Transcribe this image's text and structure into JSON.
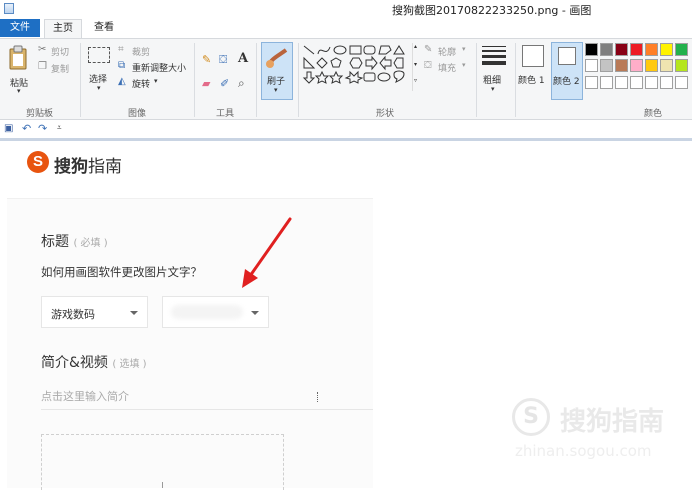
{
  "window": {
    "title": "搜狗截图20170822233250.png - 画图"
  },
  "ribbon_tabs": {
    "file": "文件",
    "home": "主页",
    "view": "查看"
  },
  "clipboard": {
    "paste_label": "粘贴",
    "cut_label": "剪切",
    "copy_label": "复制",
    "group_label": "剪贴板"
  },
  "image": {
    "select_label": "选择",
    "crop_label": "裁剪",
    "resize_label": "重新调整大小",
    "rotate_label": "旋转",
    "group_label": "图像"
  },
  "tools": {
    "text_tool_glyph": "A",
    "group_label": "工具"
  },
  "brushes": {
    "label": "刷子"
  },
  "shapes": {
    "outline_label": "轮廓",
    "fill_label": "填充",
    "group_label": "形状"
  },
  "size": {
    "label": "粗细"
  },
  "colors": {
    "color1_label": "颜色 1",
    "color2_label": "颜色 2",
    "group_label": "颜色",
    "palette_row1": [
      "#000000",
      "#7f7f7f",
      "#880015",
      "#ed1c24",
      "#ff7f27",
      "#fff200",
      "#22b14c"
    ],
    "palette_row2": [
      "#ffffff",
      "#c3c3c3",
      "#b97a57",
      "#ffaec9",
      "#ffc90e",
      "#efe4b0",
      "#b5e61d"
    ]
  },
  "canvas": {
    "logo_mark": "S",
    "logo_part1": "搜狗",
    "logo_part2": "指南",
    "title_label": "标题",
    "title_hint": "( 必填 )",
    "question": "如何用画图软件更改图片文字？",
    "category_value": "游戏数码",
    "intro_label": "简介&视频",
    "intro_hint": "( 选填 )",
    "intro_placeholder": "点击这里输入简介",
    "watermark_mark": "S",
    "watermark_text": "搜狗指南",
    "watermark_url": "zhinan.sogou.com",
    "arrow_color": "#e02020"
  }
}
